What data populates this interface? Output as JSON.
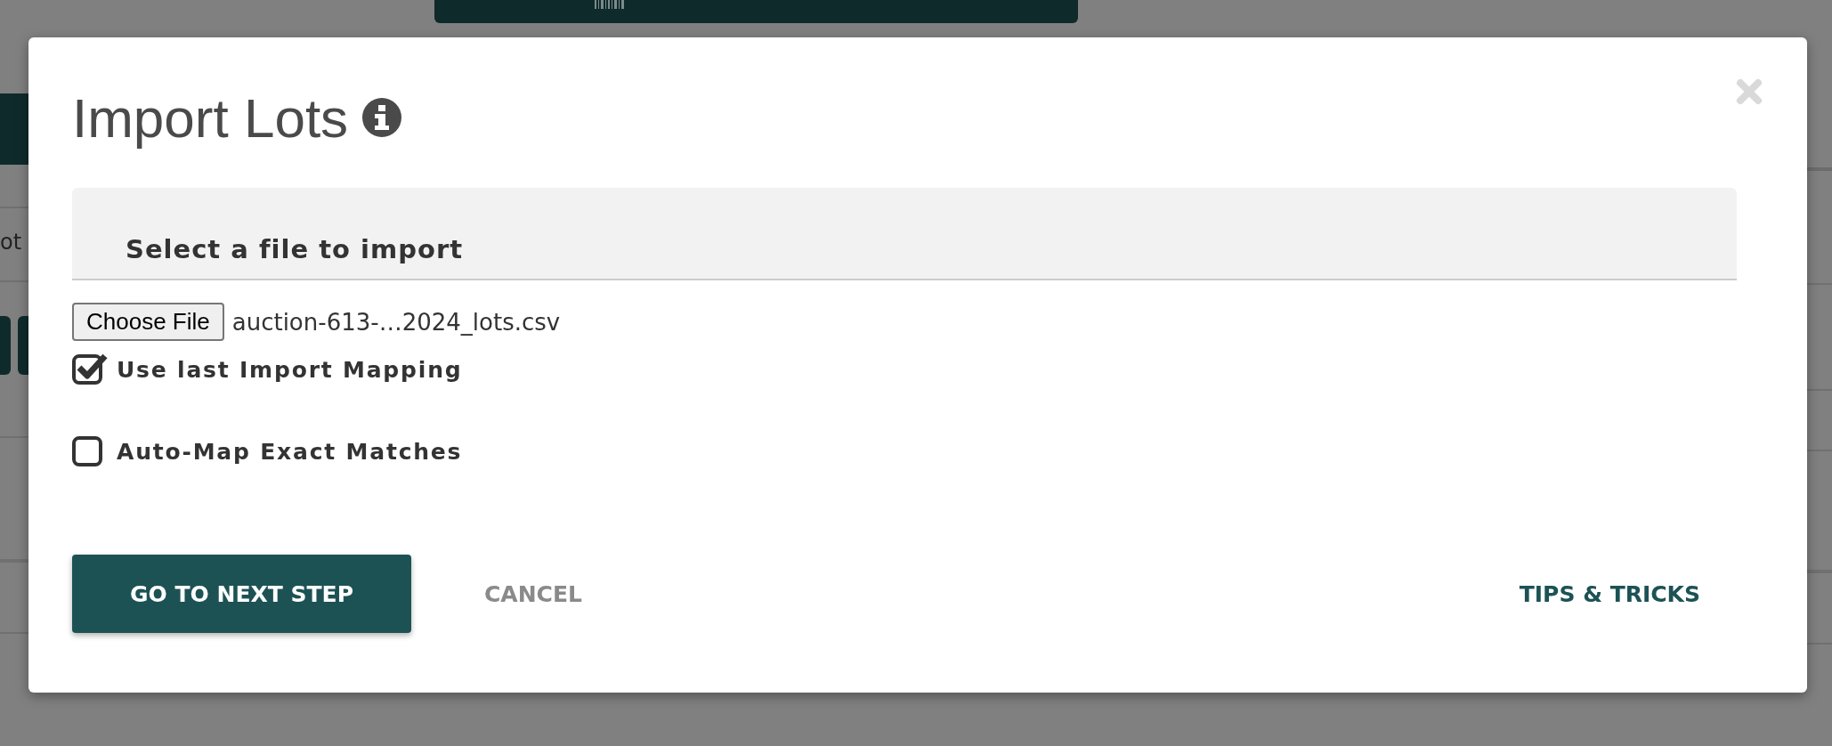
{
  "background": {
    "left_fragment": "ot"
  },
  "dialog": {
    "title": "Import Lots",
    "section_heading": "Select a file to import",
    "file_input": {
      "button": "Choose File",
      "file_name": "auction-613-…2024_lots.csv"
    },
    "options": [
      {
        "label": "Use last Import Mapping",
        "checked": true
      },
      {
        "label": "Auto-Map Exact Matches",
        "checked": false
      }
    ],
    "buttons": [
      {
        "label": "GO TO NEXT STEP",
        "kind": "primary"
      },
      {
        "label": "CANCEL",
        "kind": "secondary"
      },
      {
        "label": "TIPS & TRICKS",
        "kind": "link"
      }
    ]
  }
}
